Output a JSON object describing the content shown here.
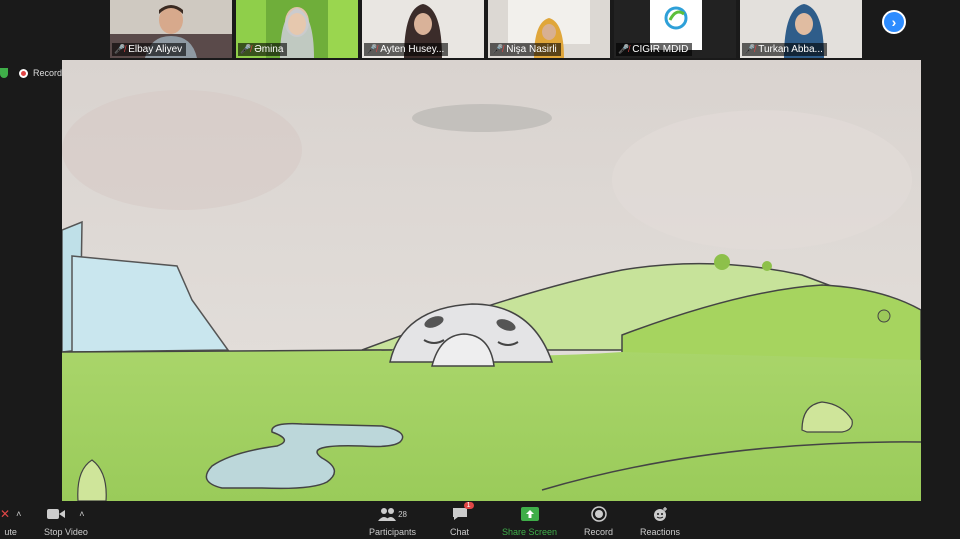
{
  "participants": [
    {
      "name": "Elbay Aliyev"
    },
    {
      "name": "Əmina"
    },
    {
      "name": "Ayten Husey..."
    },
    {
      "name": "Nişa Nasirli"
    },
    {
      "name": "CIGIR MDID"
    },
    {
      "name": "Turkan Abba..."
    }
  ],
  "recording": {
    "label": "Recording"
  },
  "toolbar": {
    "mute_label": "ute",
    "video_label": "Stop Video",
    "participants_label": "Participants",
    "participants_count": "28",
    "chat_label": "Chat",
    "chat_badge": "1",
    "share_label": "Share Screen",
    "record_label": "Record",
    "reactions_label": "Reactions"
  },
  "colors": {
    "accent_green": "#3fae49",
    "accent_blue": "#2d8cff",
    "mute_red": "#e04646"
  }
}
